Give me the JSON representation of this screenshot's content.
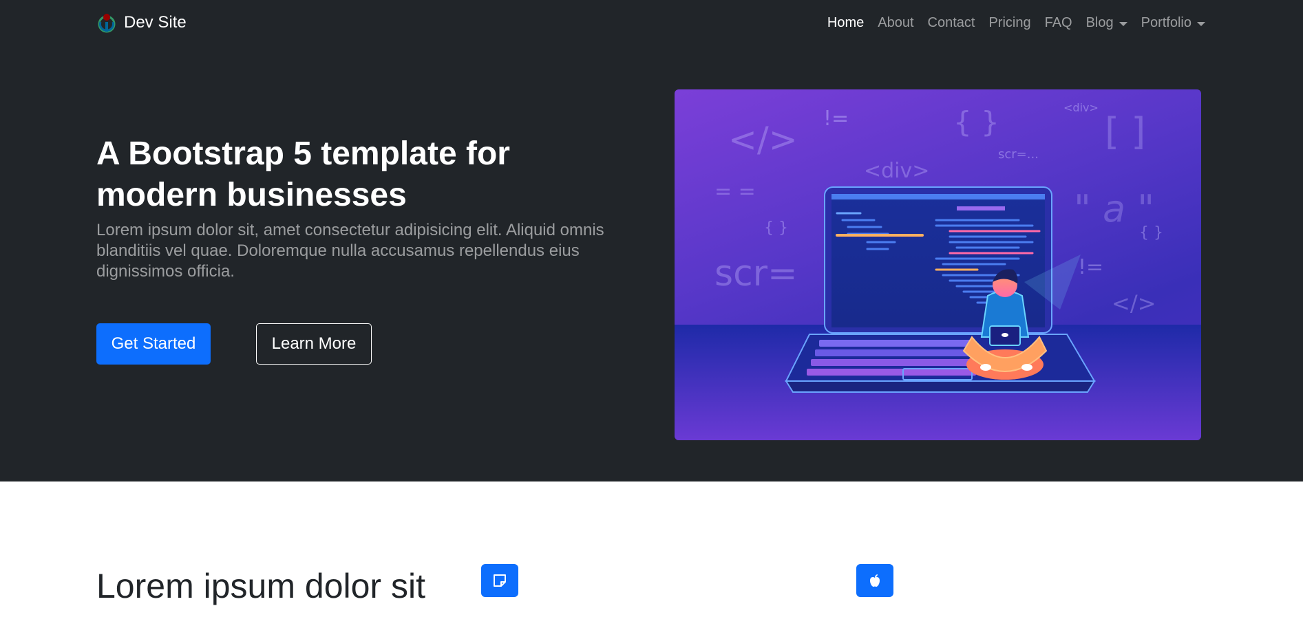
{
  "brand": {
    "name": "Dev Site",
    "logo_icon": "wikimedia-logo-icon"
  },
  "nav": {
    "items": [
      {
        "label": "Home",
        "active": true
      },
      {
        "label": "About"
      },
      {
        "label": "Contact"
      },
      {
        "label": "Pricing"
      },
      {
        "label": "FAQ"
      },
      {
        "label": "Blog",
        "dropdown": true
      },
      {
        "label": "Portfolio",
        "dropdown": true
      }
    ]
  },
  "hero": {
    "title": "A Bootstrap 5 template for modern businesses",
    "lead": "Lorem ipsum dolor sit, amet consectetur adipisicing elit. Aliquid omnis blanditiis vel quae. Doloremque nulla accusamus repellendus eius dignissimos officia.",
    "primary_button": "Get Started",
    "secondary_button": "Learn More",
    "illustration": {
      "code_symbols": [
        "</>",
        "!=",
        "{ }",
        "<div>",
        "[ ]",
        "scr=...",
        "<div>",
        "= =",
        "\" a \"",
        "{ }",
        "{ }",
        "scr=",
        "!=",
        "</>"
      ]
    }
  },
  "features": {
    "title": "Lorem ipsum dolor sit",
    "icons": [
      "sticky-note-icon",
      "apple-icon"
    ]
  },
  "colors": {
    "dark_bg": "#212529",
    "primary": "#0d6efd",
    "muted_text": "rgba(255,255,255,0.55)",
    "illustration_purple": "#7b3fd8",
    "illustration_blue": "#3a2fb8"
  }
}
